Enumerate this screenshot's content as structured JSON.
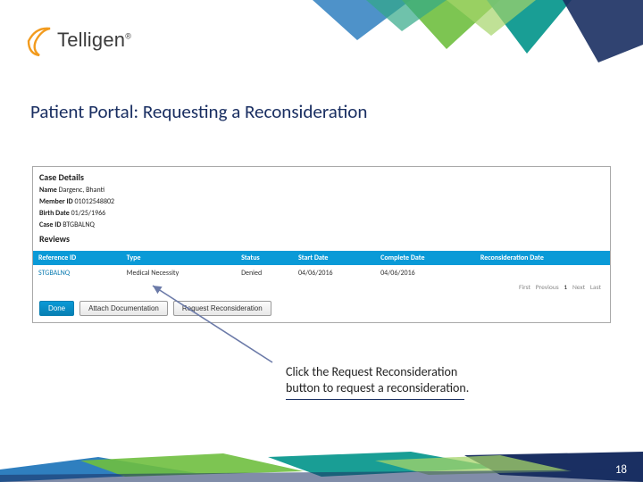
{
  "brand": {
    "name": "Telligen",
    "reg": "®"
  },
  "title": "Patient Portal:  Requesting a Reconsideration",
  "case_details": {
    "section_label": "Case Details",
    "fields": {
      "name_label": "Name",
      "name_value": "Dargenc, Bhanti",
      "member_label": "Member ID",
      "member_value": "01012548802",
      "birth_label": "Birth Date",
      "birth_value": "01/25/1966",
      "caseid_label": "Case ID",
      "caseid_value": "BTGBALNQ"
    }
  },
  "reviews": {
    "section_label": "Reviews",
    "columns": {
      "ref": "Reference ID",
      "type": "Type",
      "status": "Status",
      "start": "Start Date",
      "complete": "Complete Date",
      "reconsider": "Reconsideration Date"
    },
    "row": {
      "ref": "STGBALNQ",
      "type": "Medical Necessity",
      "status": "Denied",
      "start": "04/06/2016",
      "complete": "04/06/2016",
      "reconsider": ""
    },
    "pager": {
      "first": "First",
      "prev": "Previous",
      "curr": "1",
      "next": "Next",
      "last": "Last"
    }
  },
  "actions": {
    "done": "Done",
    "attach": "Attach Documentation",
    "request": "Request Reconsideration"
  },
  "instruction": "Click the Request Reconsideration button to request a reconsideration.",
  "page_number": "18"
}
